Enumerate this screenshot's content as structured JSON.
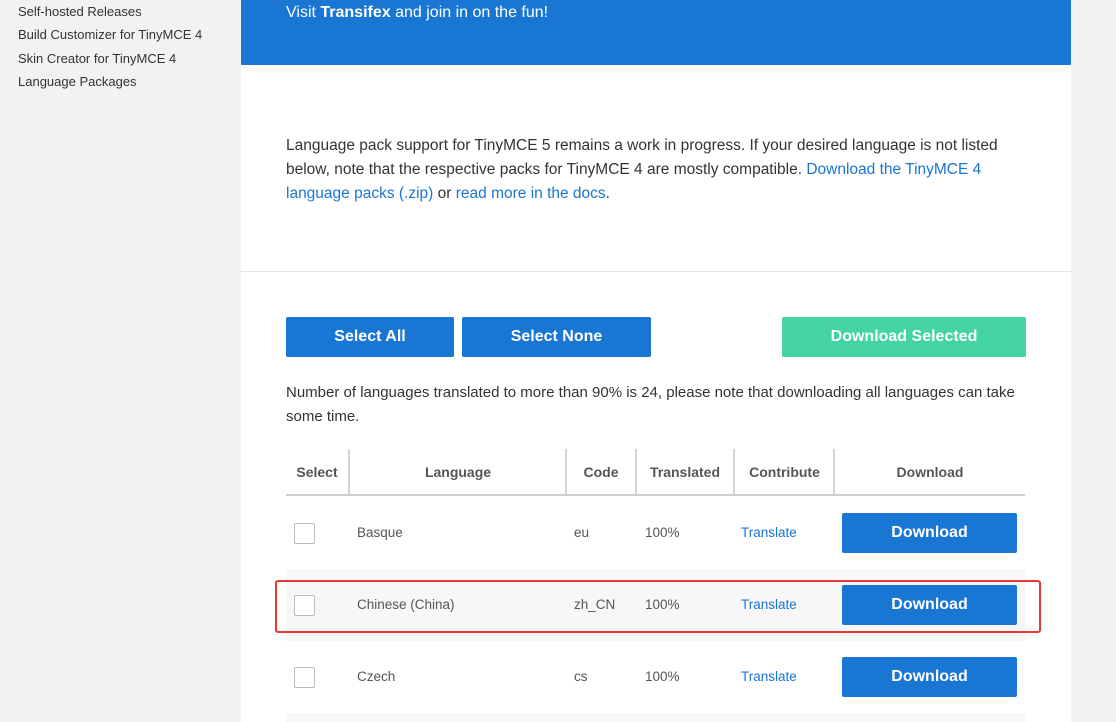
{
  "sidebar": {
    "items": [
      {
        "label": "Self-hosted Releases"
      },
      {
        "label": "Build Customizer for TinyMCE 4"
      },
      {
        "label": "Skin Creator for TinyMCE 4"
      },
      {
        "label": "Language Packages"
      }
    ]
  },
  "banner": {
    "prefix": "Visit ",
    "link": "Transifex",
    "suffix": " and join in on the fun!"
  },
  "intro": {
    "text": "Language pack support for TinyMCE 5 remains a work in progress. If your desired language is not listed below, note that the respective packs for TinyMCE 4 are mostly compatible. ",
    "link1": "Download the TinyMCE 4 language packs (.zip)",
    "mid": " or ",
    "link2": "read more in the docs",
    "end": "."
  },
  "toolbar": {
    "select_all": "Select All",
    "select_none": "Select None",
    "download_selected": "Download Selected"
  },
  "note": "Number of languages translated to more than 90% is 24, please note that downloading all languages can take some time.",
  "table": {
    "headers": {
      "select": "Select",
      "language": "Language",
      "code": "Code",
      "translated": "Translated",
      "contribute": "Contribute",
      "download": "Download"
    },
    "rows": [
      {
        "language": "Basque",
        "code": "eu",
        "translated": "100%",
        "contribute": "Translate",
        "download": "Download"
      },
      {
        "language": "Chinese (China)",
        "code": "zh_CN",
        "translated": "100%",
        "contribute": "Translate",
        "download": "Download"
      },
      {
        "language": "Czech",
        "code": "cs",
        "translated": "100%",
        "contribute": "Translate",
        "download": "Download"
      }
    ]
  },
  "colors": {
    "primary": "#1976d2",
    "accent_green": "#44d4a4",
    "highlight_border": "#e53935"
  }
}
